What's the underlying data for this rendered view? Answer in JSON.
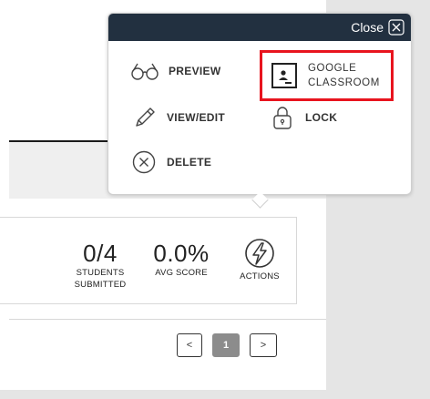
{
  "popover": {
    "close_label": "Close",
    "items": {
      "preview": "PREVIEW",
      "google_classroom_line1": "GOOGLE",
      "google_classroom_line2": "CLASSROOM",
      "view_edit": "VIEW/EDIT",
      "lock": "LOCK",
      "delete": "DELETE"
    },
    "highlight_color": "#e8141e",
    "header_color": "#223040"
  },
  "stats": {
    "students_value": "0/4",
    "students_label_line1": "STUDENTS",
    "students_label_line2": "SUBMITTED",
    "avg_value": "0.0%",
    "avg_label": "AVG SCORE",
    "actions_label": "ACTIONS"
  },
  "pagination": {
    "prev": "<",
    "current": "1",
    "next": ">"
  },
  "icons": {
    "preview": "glasses-icon",
    "classroom": "google-classroom-icon",
    "view_edit": "pencil-icon",
    "lock": "lock-icon",
    "delete": "x-circle-icon",
    "actions": "lightning-circle-icon",
    "close": "close-x-icon"
  }
}
